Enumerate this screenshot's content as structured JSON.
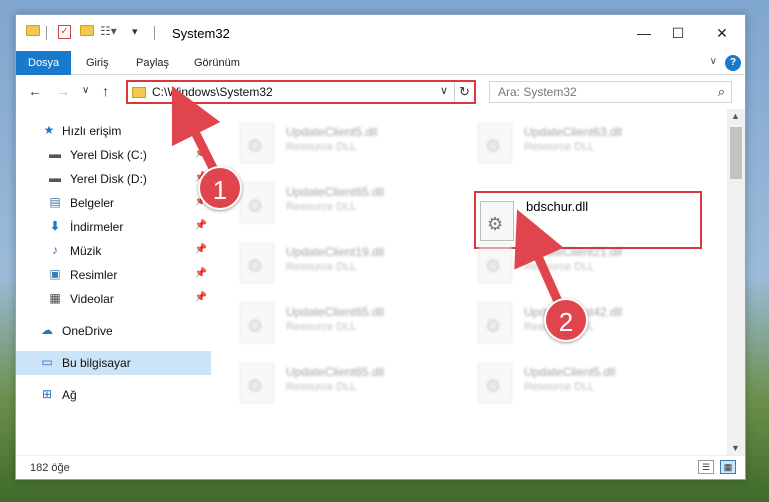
{
  "window": {
    "title": "System32"
  },
  "ribbon": {
    "tabs": [
      {
        "label": "Dosya",
        "active": true
      },
      {
        "label": "Giriş",
        "active": false
      },
      {
        "label": "Paylaş",
        "active": false
      },
      {
        "label": "Görünüm",
        "active": false
      }
    ]
  },
  "address": {
    "path": "C:\\Windows\\System32",
    "search_placeholder": "Ara: System32"
  },
  "nav": {
    "items": [
      {
        "label": "Hızlı erişim",
        "icon": "star-icon",
        "pinned": false
      },
      {
        "label": "Yerel Disk (C:)",
        "icon": "drive-icon",
        "pinned": true
      },
      {
        "label": "Yerel Disk (D:)",
        "icon": "drive-icon",
        "pinned": true
      },
      {
        "label": "Belgeler",
        "icon": "documents-icon",
        "pinned": true
      },
      {
        "label": "İndirmeler",
        "icon": "download-icon",
        "pinned": true
      },
      {
        "label": "Müzik",
        "icon": "music-icon",
        "pinned": true
      },
      {
        "label": "Resimler",
        "icon": "pictures-icon",
        "pinned": true
      },
      {
        "label": "Videolar",
        "icon": "video-icon",
        "pinned": true
      },
      {
        "label": "OneDrive",
        "icon": "cloud-icon",
        "pinned": false
      },
      {
        "label": "Bu bilgisayar",
        "icon": "computer-icon",
        "pinned": false,
        "selected": true
      },
      {
        "label": "Ağ",
        "icon": "network-icon",
        "pinned": false
      }
    ]
  },
  "files": {
    "left": [
      {
        "name": "UpdateClient5.dll",
        "type": "Resource DLL"
      },
      {
        "name": "UpdateClient65.dll",
        "type": "Resource DLL"
      },
      {
        "name": "UpdateClient19.dll",
        "type": "Resource DLL"
      },
      {
        "name": "UpdateClient65.dll",
        "type": "Resource DLL"
      },
      {
        "name": "UpdateClient65.dll",
        "type": "Resource DLL"
      }
    ],
    "right": [
      {
        "name": "UpdateClient63.dll",
        "type": "Resource DLL"
      },
      {
        "name": "bdschur.dll",
        "type": ""
      },
      {
        "name": "UpdateClient21.dll",
        "type": "Resource DLL"
      },
      {
        "name": "UpdateClient42.dll",
        "type": "Resource DLL"
      },
      {
        "name": "UpdateClient5.dll",
        "type": "Resource DLL"
      }
    ]
  },
  "status": {
    "count": "182 öğe"
  },
  "annotations": {
    "badge1": "1",
    "badge2": "2",
    "color": "#e0444c"
  }
}
